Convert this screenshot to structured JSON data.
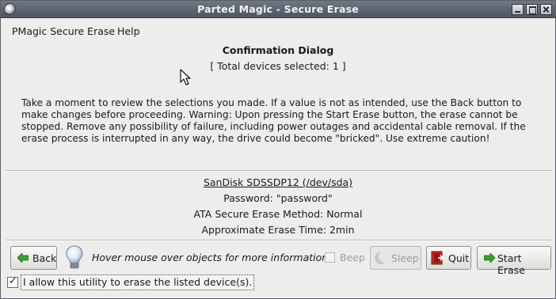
{
  "window": {
    "title": "Parted Magic - Secure Erase"
  },
  "menu": {
    "items": [
      {
        "label": "PMagic Secure Erase"
      },
      {
        "label": "Help"
      }
    ]
  },
  "dialog": {
    "heading": "Confirmation Dialog",
    "subheading": "[ Total devices selected: 1 ]",
    "warning": "Take a moment to review the selections you made. If a value is not as intended, use the Back button to make changes before proceeding. Warning: Upon pressing the Start Erase button, the erase cannot be stopped. Remove any possibility of failure, including power outages and accidental cable removal. If the erase process is interrupted in any way, the drive could become \"bricked\". Use extreme caution!"
  },
  "device": {
    "name": "SanDisk SDSSDP12 (/dev/sda)",
    "password": "Password: \"password\"",
    "method": "ATA Secure Erase Method: Normal",
    "time": "Approximate Erase Time: 2min"
  },
  "toolbar": {
    "back_label": "Back",
    "hint": "Hover mouse over objects for more information",
    "beep_label": "Beep",
    "beep_checked": false,
    "sleep_label": "Sleep",
    "quit_label": "Quit",
    "start_label": "Start Erase"
  },
  "consent": {
    "label": "I allow this utility to erase the listed device(s).",
    "checked": true
  },
  "icons": {
    "app": "parted-magic-icon",
    "back": "green-left-arrow-icon",
    "hint": "lightbulb-icon",
    "sleep": "moon-icon",
    "quit": "exit-door-icon",
    "start": "green-right-arrow-icon"
  },
  "colors": {
    "titlebar": "#5d6570",
    "window_bg": "#ededeb",
    "arrow_green": "#3aa02e",
    "quit_red": "#c62b22"
  }
}
